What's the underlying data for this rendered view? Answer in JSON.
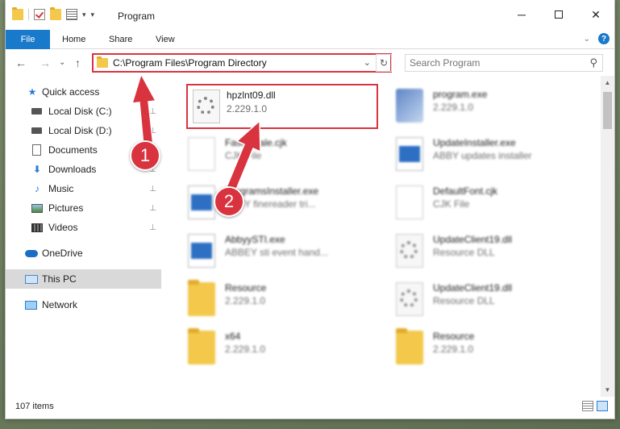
{
  "window": {
    "title": "Program",
    "controls": {
      "minimize": "─",
      "close": "✕"
    }
  },
  "quick_access_toolbar": {
    "dropdown": "▾",
    "separator_dd": "▾"
  },
  "ribbon": {
    "tabs": [
      {
        "label": "File"
      },
      {
        "label": "Home"
      },
      {
        "label": "Share"
      },
      {
        "label": "View"
      }
    ],
    "expand_chevron": "⌄",
    "help": "?"
  },
  "navigation": {
    "back": "←",
    "forward": "→",
    "recent": "⌄",
    "up": "↑",
    "address_path": "C:\\Program Files\\Program Directory",
    "address_dropdown": "⌄",
    "refresh": "↻",
    "search_placeholder": "Search Program",
    "search_icon": "⚲"
  },
  "nav_pane": {
    "items": [
      {
        "label": "Quick access",
        "icon": "star-icon",
        "pinned": false
      },
      {
        "label": "Local Disk (C:)",
        "icon": "disk-icon",
        "pinned": true
      },
      {
        "label": "Local Disk (D:)",
        "icon": "disk-icon",
        "pinned": true
      },
      {
        "label": "Documents",
        "icon": "document-icon",
        "pinned": true
      },
      {
        "label": "Downloads",
        "icon": "download-icon",
        "pinned": true
      },
      {
        "label": "Music",
        "icon": "music-icon",
        "pinned": true
      },
      {
        "label": "Pictures",
        "icon": "pictures-icon",
        "pinned": true
      },
      {
        "label": "Videos",
        "icon": "videos-icon",
        "pinned": true
      },
      {
        "label": "OneDrive",
        "icon": "cloud-icon",
        "pinned": false
      },
      {
        "label": "This PC",
        "icon": "computer-icon",
        "pinned": false,
        "selected": true
      },
      {
        "label": "Network",
        "icon": "network-icon",
        "pinned": false
      }
    ],
    "pin_glyph": "📌"
  },
  "files": [
    {
      "name": "hpzlnt09.dll",
      "meta": "2.229.1.0",
      "icon": "dll-file-icon",
      "highlighted": true
    },
    {
      "name": "program.exe",
      "meta": "2.229.1.0",
      "icon": "program-exe-icon"
    },
    {
      "name": "FastLocale.cjk",
      "meta": "CJK File",
      "icon": "blank-file-icon"
    },
    {
      "name": "UpdateInstaller.exe",
      "meta": "ABBY updates installer",
      "icon": "exe-file-icon"
    },
    {
      "name": "ProgramsInstaller.exe",
      "meta": "ABBY finereader tri...",
      "icon": "exe-file-icon"
    },
    {
      "name": "DefaultFont.cjk",
      "meta": "CJK File",
      "icon": "blank-file-icon"
    },
    {
      "name": "AbbyySTI.exe",
      "meta": "ABBEY sti event hand...",
      "icon": "exe-file-icon"
    },
    {
      "name": "UpdateClient19.dll",
      "meta": "Resource DLL",
      "icon": "dll-file-icon"
    },
    {
      "name": "Resource",
      "meta": "2.229.1.0",
      "icon": "folder-icon"
    },
    {
      "name": "UpdateClient19.dll",
      "meta": "Resource DLL",
      "icon": "dll-file-icon"
    },
    {
      "name": "x64",
      "meta": "2.229.1.0",
      "icon": "folder-icon"
    },
    {
      "name": "Resource",
      "meta": "2.229.1.0",
      "icon": "folder-icon"
    }
  ],
  "status": {
    "item_count": "107 items"
  },
  "scrollbar": {
    "up": "▲",
    "down": "▼"
  },
  "annotations": [
    {
      "label": "1"
    },
    {
      "label": "2"
    }
  ],
  "colors": {
    "accent": "#1979ca",
    "highlight_border": "#d9333f",
    "callout": "#d9333f"
  }
}
